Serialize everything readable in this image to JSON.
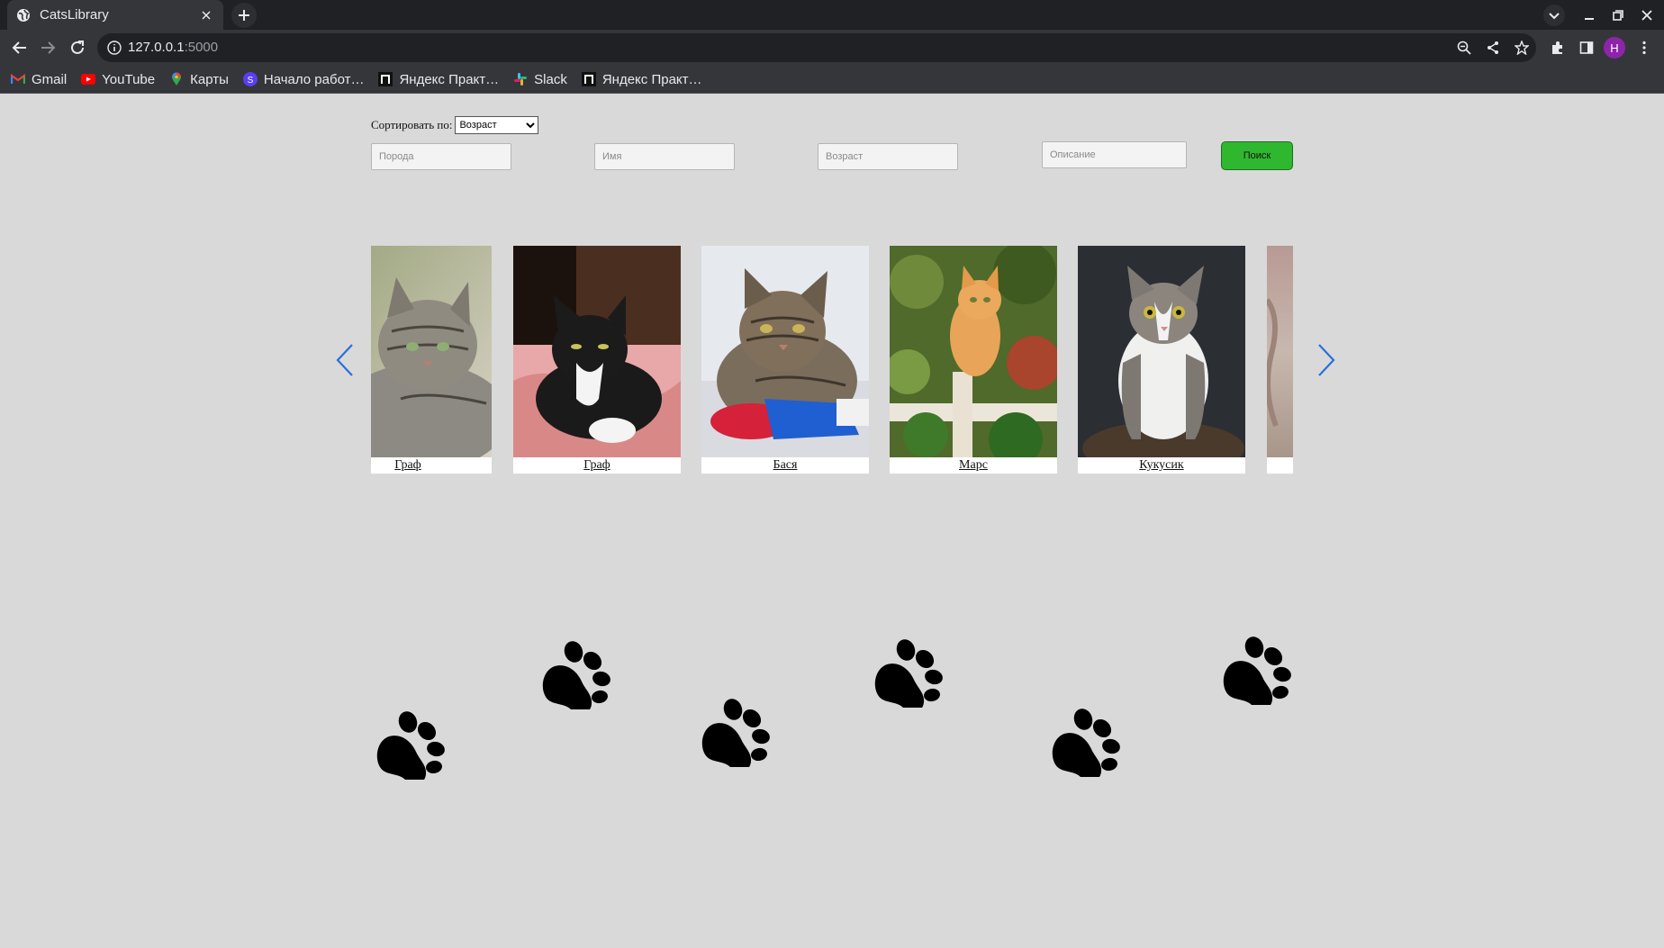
{
  "browser": {
    "tab_title": "CatsLibrary",
    "url_host": "127.0.0.1",
    "url_port": ":5000",
    "profile_initial": "H",
    "bookmarks": [
      {
        "label": "Gmail",
        "icon": "gmail-icon"
      },
      {
        "label": "YouTube",
        "icon": "youtube-icon"
      },
      {
        "label": "Карты",
        "icon": "maps-icon"
      },
      {
        "label": "Начало работ…",
        "icon": "s-app-icon"
      },
      {
        "label": "Яндекс Практ…",
        "icon": "yandex-practicum-icon"
      },
      {
        "label": "Slack",
        "icon": "slack-icon"
      },
      {
        "label": "Яндекс Практ…",
        "icon": "yandex-practicum-icon"
      }
    ]
  },
  "filters": {
    "sort_label": "Сортировать по:",
    "sort_selected": "Возраст",
    "breed_placeholder": "Порода",
    "name_placeholder": "Имя",
    "age_placeholder": "Возраст",
    "description_placeholder": "Описание",
    "search_label": "Поиск"
  },
  "cats": [
    {
      "name": "Граф"
    },
    {
      "name": "Граф"
    },
    {
      "name": "Бася"
    },
    {
      "name": "Марс"
    },
    {
      "name": "Кукусик"
    },
    {
      "name": ""
    }
  ],
  "colors": {
    "page_bg": "#d9d9d9",
    "search_button": "#2fb72f",
    "carousel_arrow": "#2a6fdb"
  }
}
